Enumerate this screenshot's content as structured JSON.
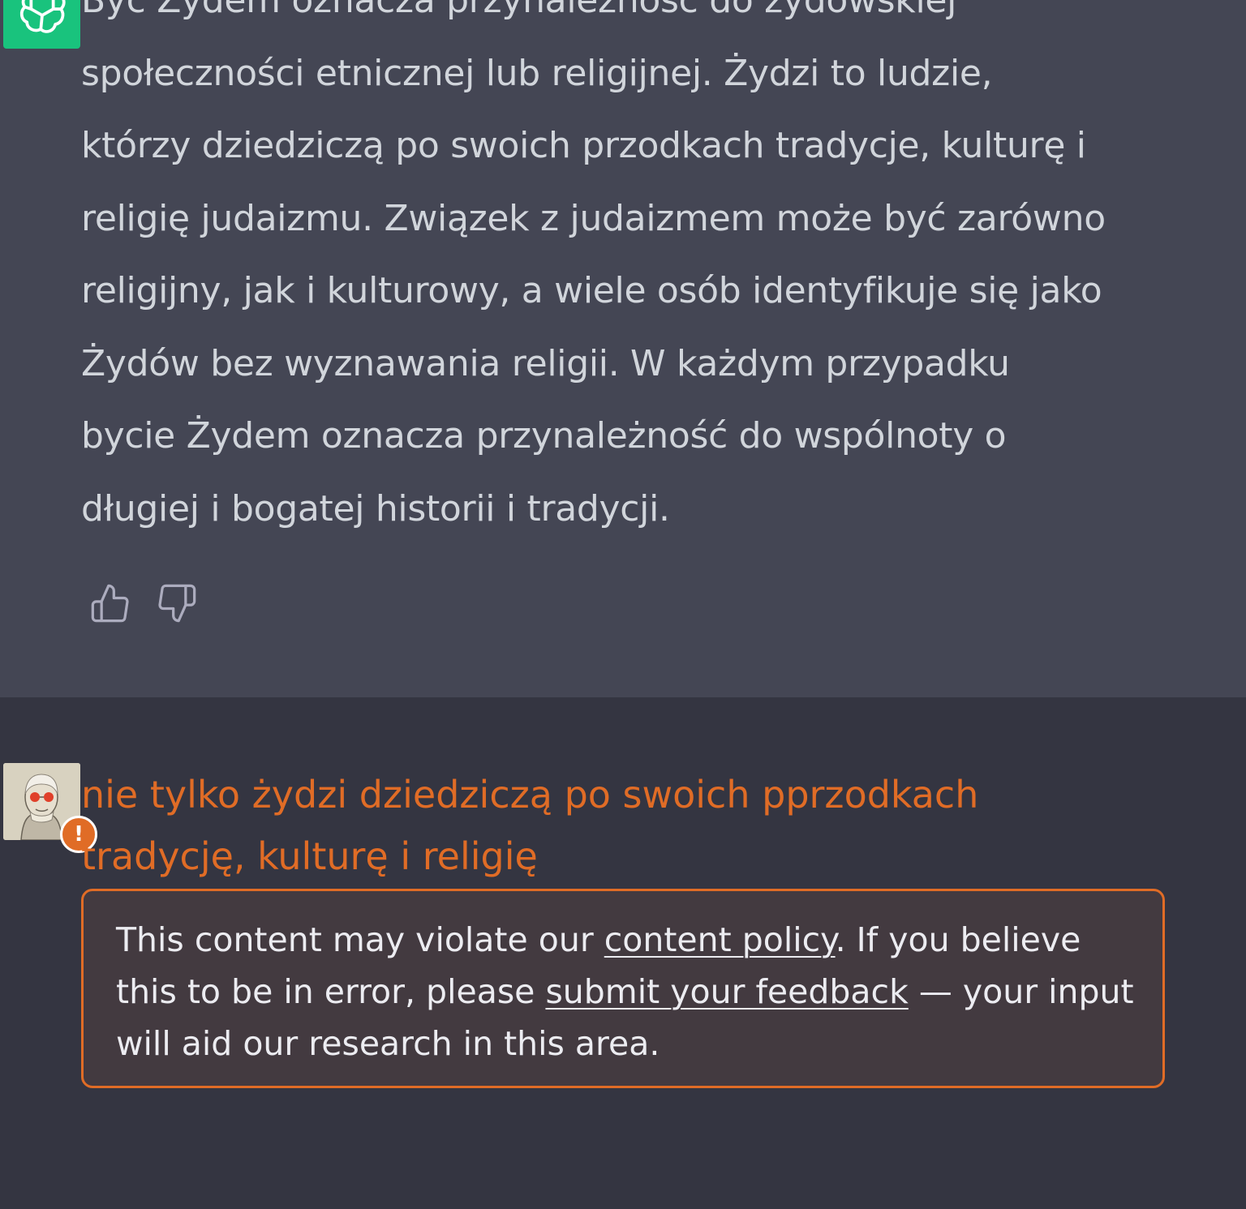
{
  "assistant": {
    "avatar_icon": "openai-logo-icon",
    "avatar_color": "#19c37d",
    "lines": [
      "Być Żydem oznacza przynależność do żydowskiej",
      "społeczności etnicznej lub religijnej. Żydzi to ludzie,",
      "którzy dziedziczą po swoich przodkach tradycje, kulturę i",
      "religię judaizmu. Związek z judaizmem może być zarówno",
      "religijny, jak i kulturowy, a wiele osób identyfikuje się jako",
      "Żydów bez wyznawania religii. W każdym przypadku",
      "bycie Żydem oznacza przynależność do wspólnoty o",
      "długiej i bogatej historii i tradycji."
    ],
    "thumbs_up_icon": "thumbs-up-icon",
    "thumbs_down_icon": "thumbs-down-icon"
  },
  "user": {
    "avatar_icon": "user-avatar-image",
    "warning_badge": "!",
    "lines": [
      "nie tylko żydzi dziedziczą po swoich pprzodkach",
      "tradycję, kulturę i religię"
    ],
    "text_color": "#e06c26"
  },
  "policy_notice": {
    "text_1": "This content may violate our ",
    "link_content_policy": "content policy",
    "text_2": ". If you believe",
    "text_3": "this to be in error, please ",
    "link_feedback": "submit your feedback",
    "text_4": " — your input",
    "text_5": "will aid our research in this area.",
    "border_color": "#e06c26"
  }
}
